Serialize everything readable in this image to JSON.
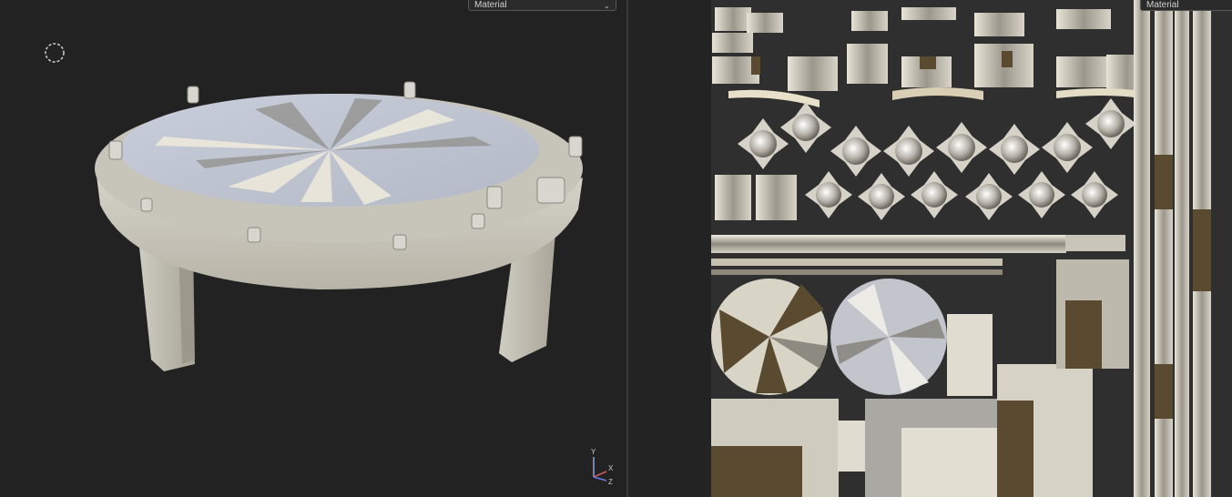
{
  "viewport3d": {
    "shading_dropdown": {
      "selected": "Material"
    },
    "gizmo": {
      "axis_y": "Y",
      "axis_x": "X",
      "axis_z": "Z"
    }
  },
  "uv_editor": {
    "shading_dropdown": {
      "selected": "Material"
    }
  },
  "colors": {
    "background": "#222222",
    "texture_light": "#dcd8cc",
    "texture_dark": "#5a4a30",
    "gizmo_y": "#8aa8d8",
    "gizmo_x": "#d05a5a",
    "gizmo_z": "#6a7ae0"
  }
}
